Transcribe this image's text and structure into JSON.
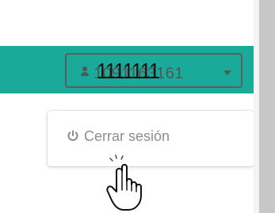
{
  "header": {
    "username_primary": "1111111",
    "username_secondary": "1091163161"
  },
  "menu": {
    "logout_label": "Cerrar sesión"
  },
  "icons": {
    "user": "user-icon",
    "caret": "chevron-down-icon",
    "power": "power-icon",
    "cursor": "hand-cursor-icon"
  },
  "colors": {
    "navbar": "#19aa9a",
    "button_border": "#5d5d5d",
    "menu_text": "#8d8d8d",
    "scrollbar": "#c7c7c7"
  }
}
